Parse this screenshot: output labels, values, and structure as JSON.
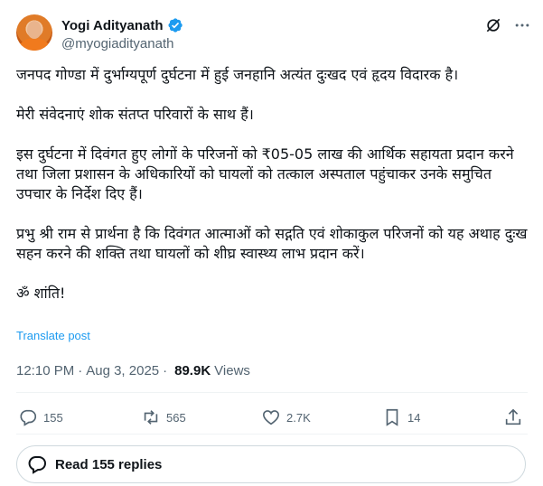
{
  "author": {
    "display_name": "Yogi Adityanath",
    "handle": "@myogiadityanath",
    "verified": true,
    "verified_color": "#1d9bf0",
    "avatar": "avatar-photo"
  },
  "header_icons": [
    "grok-icon",
    "more-icon"
  ],
  "tweet": {
    "paragraphs": [
      "जनपद गोण्डा में दुर्भाग्यपूर्ण दुर्घटना में हुई जनहानि अत्यंत दुःखद एवं हृदय विदारक है।",
      "मेरी संवेदनाएं शोक संतप्त परिवारों के साथ हैं।",
      "इस दुर्घटना में दिवंगत हुए लोगों के परिजनों को ₹05-05 लाख की आर्थिक सहायता प्रदान करने तथा जिला प्रशासन के अधिकारियों को घायलों को तत्काल अस्पताल पहुंचाकर उनके समुचित उपचार के निर्देश दिए हैं।",
      "प्रभु श्री राम से प्रार्थना है कि दिवंगत आत्माओं को सद्गति एवं शोकाकुल परिजनों को यह अथाह दुःख सहन करने की शक्ति तथा घायलों को शीघ्र स्वास्थ्य लाभ प्रदान करें।",
      "ॐ शांति!"
    ],
    "translate_label": "Translate post"
  },
  "meta": {
    "time": "12:10 PM",
    "date": "Aug 3, 2025",
    "separator": "·",
    "views_count": "89.9K",
    "views_label": "Views"
  },
  "actions": {
    "replies": "155",
    "reposts": "565",
    "likes": "2.7K",
    "bookmarks": "14"
  },
  "read_replies_label": "Read 155 replies",
  "colors": {
    "text": "#0f1419",
    "secondary": "#536471",
    "link": "#1d9bf0",
    "border": "#cfd9de"
  }
}
